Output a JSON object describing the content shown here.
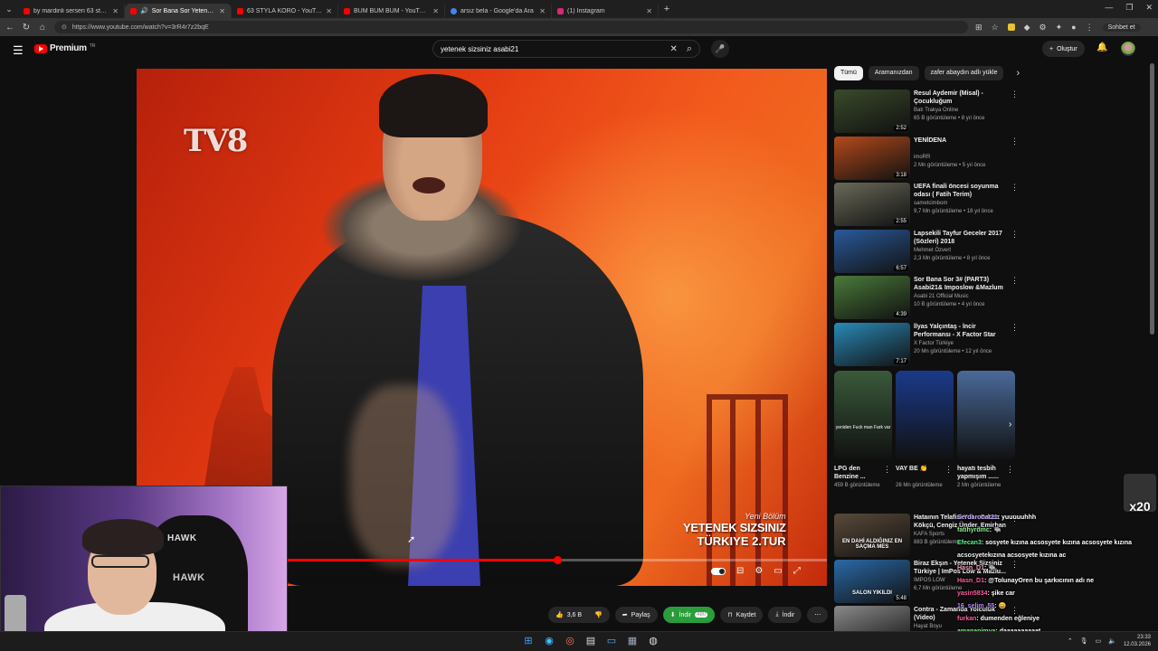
{
  "browser": {
    "tabs": [
      {
        "title": "by mardinli serseri 63 style indir -",
        "favicon": "youtube-icon",
        "active": false
      },
      {
        "title": "Sor Bana Sor Yetenek Sizsiniz",
        "favicon": "youtube-icon",
        "active": true
      },
      {
        "title": "63 STYLA KORO - YouTube",
        "favicon": "youtube-icon",
        "active": false
      },
      {
        "title": "BUM BUM BUM - YouTube",
        "favicon": "youtube-icon",
        "active": false
      },
      {
        "title": "arsız bela - Google'da Ara",
        "favicon": "google-icon",
        "active": false
      },
      {
        "title": "(1) Instagram",
        "favicon": "instagram-icon",
        "active": false
      }
    ],
    "url": "https://www.youtube.com/watch?v=3rR4r7z2bqE",
    "sohbet_label": "Sohbet et"
  },
  "youtube": {
    "logo_text": "Premium",
    "logo_region": "TR",
    "search_query": "yetenek sizsiniz asabi21",
    "create_label": "Oluştur"
  },
  "video": {
    "channel_logo": "TV8",
    "caption_line1": "Yeni Bölüm",
    "caption_line2": "YETENEK SIZSINIZ",
    "caption_line3": "TÜRKIYE  2.TUR",
    "progress": 0.61
  },
  "actions": {
    "likes": "3,6 B",
    "share": "Paylaş",
    "download_ext": "İndir",
    "download_badge": "480",
    "save": "Kaydet",
    "download": "İndir"
  },
  "chips": [
    "Tümü",
    "Aramanızdan",
    "zafer abaydın adlı yükle"
  ],
  "recommendations": [
    {
      "title": "Resul Aydemir (Misal) - Çocukluğum",
      "channel": "Batı Trakya Online",
      "meta": "65 B görüntüleme • 8 yıl önce",
      "duration": "2:52",
      "thumb_color": "#3a4a2a"
    },
    {
      "title": "YENİDENA",
      "channel": "imoRR",
      "meta": "2 Mn görüntüleme • 5 yıl önce",
      "duration": "3:18",
      "thumb_color": "#b44a1a"
    },
    {
      "title": "UEFA finali öncesi soyunma odası ( Fatih Terim)",
      "channel": "sametcimbom",
      "meta": "9,7 Mn görüntüleme • 18 yıl önce",
      "duration": "2:55",
      "thumb_color": "#6a6a5a"
    },
    {
      "title": "Lapsekili Tayfur Geceler 2017 (Sözleri) 2018",
      "channel": "Mehmet Özvert",
      "meta": "2,3 Mn görüntüleme • 8 yıl önce",
      "duration": "6:57",
      "thumb_color": "#2a5a9a"
    },
    {
      "title": "Sor Bana Sor 3# (PART3) Asabi21& Imposlow &Mazlum ...",
      "channel": "Asabi 21 Official Music",
      "meta": "10 B görüntüleme • 4 yıl önce",
      "duration": "4:39",
      "thumb_color": "#4a7a3a"
    },
    {
      "title": "İlyas Yalçıntaş - İncir Performansı - X Factor Star Işığı",
      "channel": "X Factor Türkiye",
      "meta": "20 Mn görüntüleme • 12 yıl önce",
      "duration": "7:17",
      "thumb_color": "#2a8ab8"
    }
  ],
  "shorts": [
    {
      "title": "LPG den Benzine ...",
      "views": "459 B görüntüleme",
      "subtitle": "yeniden\nFuck man Fark var",
      "color": "#3a5a3a"
    },
    {
      "title": "VAY BE 👏",
      "views": "26 Mn görüntüleme",
      "subtitle": "",
      "color": "#1a3a8a"
    },
    {
      "title": "hayatı tesbih yapmışım ......",
      "views": "2 Mn görüntüleme",
      "subtitle": "",
      "color": "#4a6a9a"
    }
  ],
  "recommendations2": [
    {
      "title": "Hataının Telafisi Yok - Orkun Kökçü, Cengiz Ünder, Emirhan ...",
      "channel": "KAFA Sports",
      "meta": "883 B görüntüleme",
      "duration": "",
      "thumb_color": "#5a4a3a",
      "thumb_text": "EN DAHİ ALDIĞINIZ EN SAÇMA MES"
    },
    {
      "title": "Biraz Ekşın - Yetenek Sizsiniz Türkiye | ImPos Low & Mazlu...",
      "channel": "IMPOS LOW",
      "meta": "6,7 Mn görüntüleme",
      "duration": "5:48",
      "thumb_color": "#2a6aa8",
      "thumb_text": "SALON YIKILDI"
    },
    {
      "title": "Contra - Zamanda Yolculuk (Video)",
      "channel": "Hayat Boyu",
      "meta": "",
      "duration": "",
      "thumb_color": "#8a8a8a",
      "thumb_text": ""
    }
  ],
  "chat": [
    {
      "user": "Serdaronat21",
      "color": "#c6a9ff",
      "msg": ": yuuuuuhhh"
    },
    {
      "user": "fatihyrdmc",
      "color": "#8ef08e",
      "msg": ": 🐃"
    },
    {
      "user": "Efecan3",
      "color": "#5ef58e",
      "msg": ": sosyete kızına acsosyete kızına acsosyete kızına"
    },
    {
      "user": "acsosyete",
      "color": "#f1f1f1",
      "msg": "kızına acsosyete kızına ac"
    },
    {
      "user": "Hasn_D1",
      "color": "#ff9ebd",
      "msg": ": 🐃"
    },
    {
      "user": "Hasn_D1",
      "color": "#ff5ea0",
      "msg": ": @TolunayOren bu şarkıcının adı ne"
    },
    {
      "user": "yasin5834",
      "color": "#ff5ea0",
      "msg": ": şike car"
    },
    {
      "user": "16_selim_55",
      "color": "#b889ff",
      "msg": ": 😄"
    },
    {
      "user": "furkan",
      "color": "#ff5ea0",
      "msg": ": dumenden eğleniye"
    },
    {
      "user": "amanapimya",
      "color": "#8ef08e",
      "msg": ": daaaaaaaaaat"
    }
  ],
  "emote_text": "x20",
  "webcam": {
    "chair_brand": "HAWK"
  },
  "taskbar": {
    "time": "23:33",
    "date": "12.03.2026"
  }
}
